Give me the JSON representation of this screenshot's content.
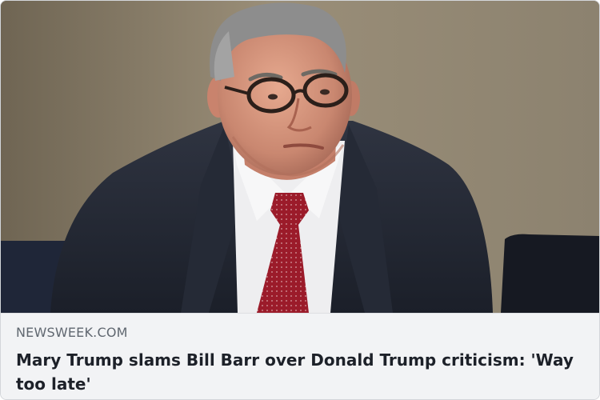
{
  "link_preview": {
    "source": "NEWSWEEK.COM",
    "headline": "Mary Trump slams Bill Barr over Donald Trump criticism: 'Way too late'",
    "image_icon": "photo-icon"
  },
  "colors": {
    "caption_background": "#f2f3f5",
    "source_text": "#606770",
    "headline_text": "#1d2129"
  }
}
